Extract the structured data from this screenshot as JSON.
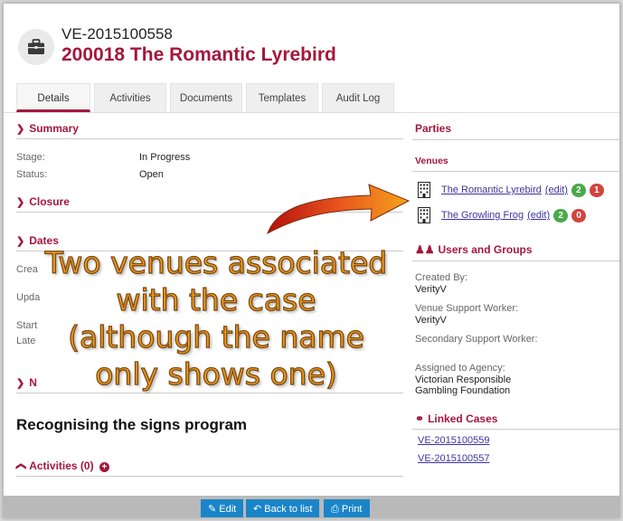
{
  "header": {
    "case_id": "VE-2015100558",
    "title": "200018 The Romantic Lyrebird"
  },
  "tabs": [
    {
      "label": "Details",
      "active": true
    },
    {
      "label": "Activities",
      "active": false
    },
    {
      "label": "Documents",
      "active": false
    },
    {
      "label": "Templates",
      "active": false
    },
    {
      "label": "Audit Log",
      "active": false
    }
  ],
  "summary": {
    "title": "Summary",
    "stage_label": "Stage:",
    "stage_value": "In Progress",
    "status_label": "Status:",
    "status_value": "Open"
  },
  "closure": {
    "title": "Closure"
  },
  "dates": {
    "title": "Dates",
    "rows": [
      {
        "label": "Crea"
      },
      {
        "label": "Upda"
      },
      {
        "label": "Start"
      },
      {
        "label": "Late"
      }
    ]
  },
  "notes": {
    "title": "N"
  },
  "program_heading": "Recognising the signs program",
  "activities_link": "Activities (0)",
  "parties": {
    "title": "Parties",
    "venues_title": "Venues",
    "venues": [
      {
        "name": "The Romantic Lyrebird",
        "edit": "(edit)",
        "badge_green": "2",
        "badge_red": "1"
      },
      {
        "name": "The Growling Frog",
        "edit": "(edit)",
        "badge_green": "2",
        "badge_red": "0"
      }
    ],
    "users_title": "Users and Groups",
    "created_by_label": "Created By:",
    "created_by_value": "VerityV",
    "venue_support_label": "Venue Support Worker:",
    "venue_support_value": "VerityV",
    "secondary_support_label": "Secondary Support Worker:",
    "assigned_label": "Assigned to Agency:",
    "assigned_value_1": "Victorian Responsible",
    "assigned_value_2": "Gambling Foundation",
    "linked_title": "Linked Cases",
    "linked_cases": [
      "VE-2015100559",
      "VE-2015100557"
    ]
  },
  "footer": {
    "edit_label": "Edit",
    "back_label": "Back to list",
    "print_label": "Print"
  },
  "annotation": {
    "line1": "Two venues associated",
    "line2": "with the case",
    "line3": "(although the name",
    "line4": "only shows one)"
  },
  "colors": {
    "brand": "#a4173d",
    "link": "#3c33a0",
    "button": "#1a85c9",
    "annotation": "#f39b1e"
  }
}
